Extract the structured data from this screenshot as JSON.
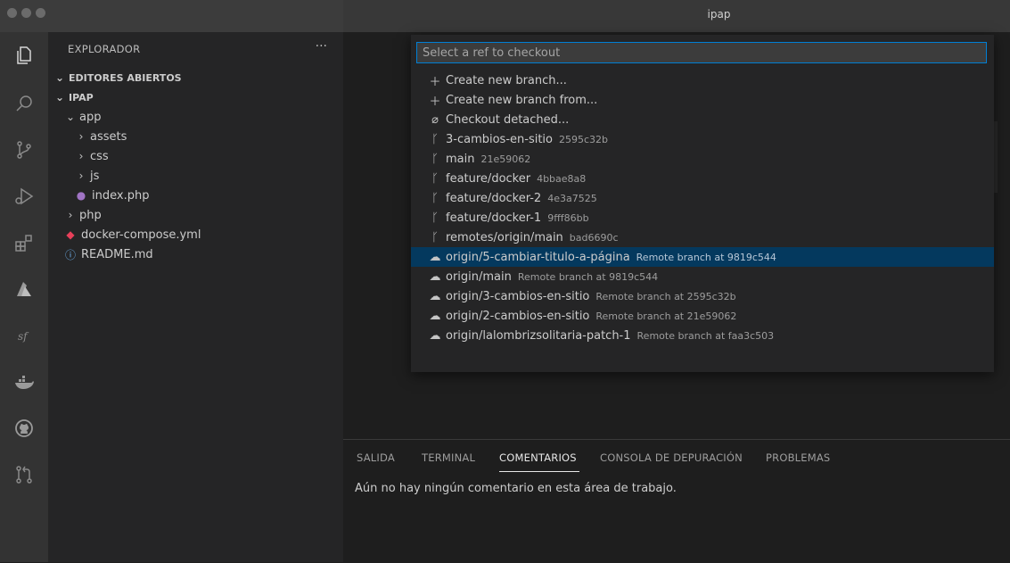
{
  "window": {
    "title": "ipap"
  },
  "sidebar": {
    "header": "EXPLORADOR",
    "more": "···",
    "tree": [
      {
        "label": "EDITORES ABIERTOS",
        "chevron": "down",
        "depth": 0,
        "bold": true
      },
      {
        "label": "IPAP",
        "chevron": "down",
        "depth": 0,
        "bold": true
      },
      {
        "label": "app",
        "chevron": "down",
        "depth": 1
      },
      {
        "label": "assets",
        "chevron": "right",
        "depth": 2
      },
      {
        "label": "css",
        "chevron": "right",
        "depth": 2
      },
      {
        "label": "js",
        "chevron": "right",
        "depth": 2
      },
      {
        "label": "index.php",
        "icon": "php-icon",
        "depth": 2
      },
      {
        "label": "php",
        "chevron": "right",
        "depth": 1
      },
      {
        "label": "docker-compose.yml",
        "icon": "docker-file-icon",
        "depth": 1
      },
      {
        "label": "README.md",
        "icon": "info-icon",
        "depth": 1
      }
    ]
  },
  "quickpick": {
    "placeholder": "Select a ref to checkout",
    "items": [
      {
        "icon": "plus-icon",
        "label": "Create new branch...",
        "desc": ""
      },
      {
        "icon": "plus-icon",
        "label": "Create new branch from...",
        "desc": ""
      },
      {
        "icon": "detached-icon",
        "label": "Checkout detached...",
        "desc": ""
      },
      {
        "icon": "branch-icon",
        "label": "3-cambios-en-sitio",
        "desc": "2595c32b"
      },
      {
        "icon": "branch-icon",
        "label": "main",
        "desc": "21e59062"
      },
      {
        "icon": "branch-icon",
        "label": "feature/docker",
        "desc": "4bbae8a8"
      },
      {
        "icon": "branch-icon",
        "label": "feature/docker-2",
        "desc": "4e3a7525"
      },
      {
        "icon": "branch-icon",
        "label": "feature/docker-1",
        "desc": "9fff86bb"
      },
      {
        "icon": "branch-icon",
        "label": "remotes/origin/main",
        "desc": "bad6690c"
      },
      {
        "icon": "cloud-icon",
        "label": "origin/5-cambiar-titulo-a-página",
        "desc": "Remote branch at 9819c544",
        "selected": true
      },
      {
        "icon": "cloud-icon",
        "label": "origin/main",
        "desc": "Remote branch at 9819c544"
      },
      {
        "icon": "cloud-icon",
        "label": "origin/3-cambios-en-sitio",
        "desc": "Remote branch at 2595c32b"
      },
      {
        "icon": "cloud-icon",
        "label": "origin/2-cambios-en-sitio",
        "desc": "Remote branch at 21e59062"
      },
      {
        "icon": "cloud-icon",
        "label": "origin/lalombrizsolitaria-patch-1",
        "desc": "Remote branch at faa3c503"
      }
    ]
  },
  "panel": {
    "tabs": [
      {
        "label": "SALIDA"
      },
      {
        "label": "TERMINAL"
      },
      {
        "label": "COMENTARIOS",
        "active": true
      },
      {
        "label": "CONSOLA DE DEPURACIÓN"
      },
      {
        "label": "PROBLEMAS"
      }
    ],
    "message": "Aún no hay ningún comentario en esta área de trabajo."
  },
  "activity_icons": [
    "explorer-icon",
    "search-icon",
    "source-control-icon",
    "run-debug-icon",
    "extensions-icon",
    "azure-icon",
    "symfony-icon",
    "docker-icon",
    "github-icon",
    "pull-request-icon"
  ],
  "colors": {
    "accent": "#007fd4",
    "selection": "#04395e",
    "sidebar": "#252526",
    "activitybar": "#333333"
  }
}
